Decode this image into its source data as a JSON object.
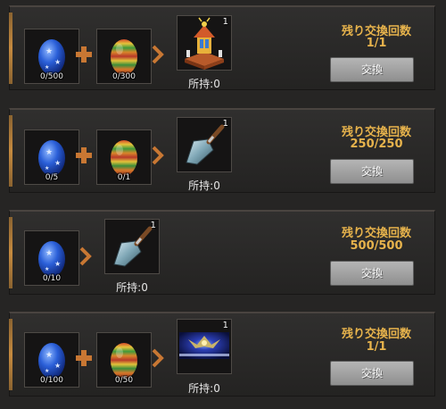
{
  "colors": {
    "accent": "#e7b34c",
    "plus_arrow": "#c87733",
    "button": "#a3a3a3"
  },
  "offers": [
    {
      "inputs": [
        {
          "icon": "blue-star-egg-icon",
          "count": "0/500"
        },
        {
          "icon": "striped-egg-icon",
          "count": "0/300"
        }
      ],
      "output": {
        "icon": "carousel-icon",
        "qty": "1",
        "owned": "所持:0"
      },
      "remaining_label": "残り交換回数",
      "remaining_value": "1/1",
      "button": "交換"
    },
    {
      "inputs": [
        {
          "icon": "blue-star-egg-icon",
          "count": "0/5"
        },
        {
          "icon": "striped-egg-icon",
          "count": "0/1"
        }
      ],
      "output": {
        "icon": "trowel-icon",
        "qty": "1",
        "owned": "所持:0"
      },
      "remaining_label": "残り交換回数",
      "remaining_value": "250/250",
      "button": "交換"
    },
    {
      "inputs": [
        {
          "icon": "blue-star-egg-icon",
          "count": "0/10"
        }
      ],
      "output": {
        "icon": "trowel-icon",
        "qty": "1",
        "owned": "所持:0"
      },
      "remaining_label": "残り交換回数",
      "remaining_value": "500/500",
      "button": "交換"
    },
    {
      "inputs": [
        {
          "icon": "blue-star-egg-icon",
          "count": "0/100"
        },
        {
          "icon": "striped-egg-icon",
          "count": "0/50"
        }
      ],
      "output": {
        "icon": "winged-emblem-banner-icon",
        "qty": "1",
        "owned": "所持:0"
      },
      "remaining_label": "残り交換回数",
      "remaining_value": "1/1",
      "button": "交換"
    }
  ]
}
